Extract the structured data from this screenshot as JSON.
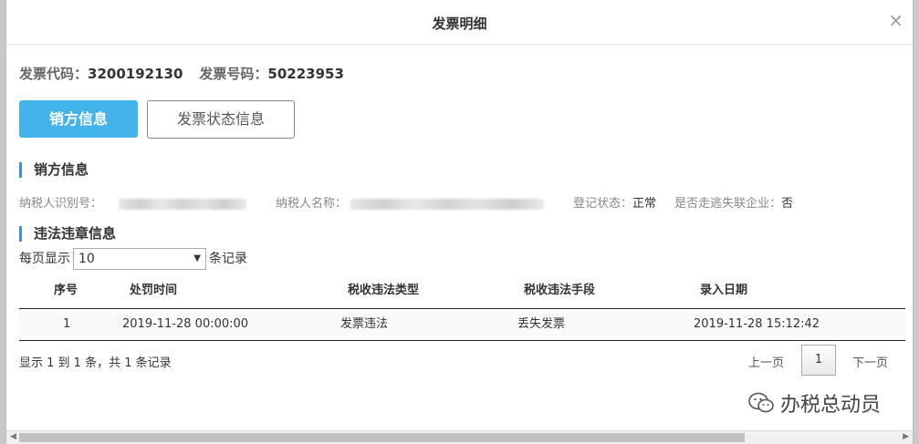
{
  "dialog": {
    "title": "发票明细",
    "close_icon": "×"
  },
  "invoice": {
    "code_label": "发票代码：",
    "code_value": "3200192130",
    "number_label": "发票号码：",
    "number_value": "50223953"
  },
  "tabs": [
    {
      "label": "销方信息",
      "active": true
    },
    {
      "label": "发票状态信息",
      "active": false
    }
  ],
  "seller_section": {
    "title": "销方信息",
    "taxpayer_id_label": "纳税人识别号：",
    "taxpayer_name_label": "纳税人名称：",
    "reg_status_label": "登记状态：",
    "reg_status_value": "正常",
    "missing_label": "是否走逃失联企业：",
    "missing_value": "否"
  },
  "violation_section": {
    "title": "违法违章信息",
    "per_page_prefix": "每页显示",
    "per_page_value": "10",
    "per_page_suffix": "条记录",
    "columns": [
      "序号",
      "处罚时间",
      "税收违法类型",
      "税收违法手段",
      "录入日期"
    ],
    "rows": [
      [
        "1",
        "2019-11-28 00:00:00",
        "发票违法",
        "丢失发票",
        "2019-11-28 15:12:42"
      ]
    ],
    "summary": "显示 1 到 1 条，共 1 条记录",
    "pager": {
      "prev": "上一页",
      "current": "1",
      "next": "下一页"
    }
  },
  "watermark": "办税总动员",
  "colors": {
    "accent": "#42b4eb",
    "section_bar": "#3a8ee6"
  }
}
